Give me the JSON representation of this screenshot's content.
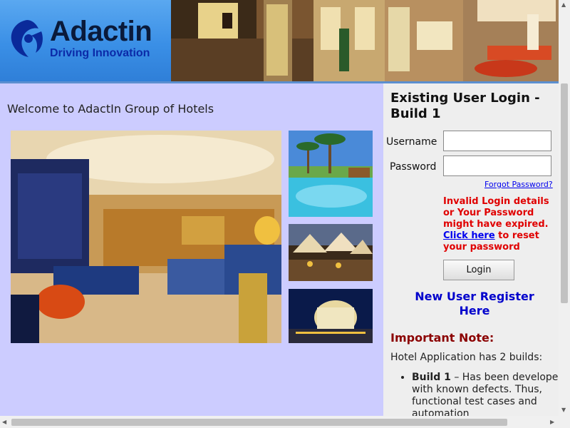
{
  "header": {
    "logo_name": "Adactin",
    "logo_tagline": "Driving Innovation"
  },
  "main": {
    "welcome": "Welcome to AdactIn Group of Hotels"
  },
  "login": {
    "title": "Existing User Login - Build 1",
    "username_label": "Username",
    "username_value": "",
    "password_label": "Password",
    "password_value": "",
    "forgot_link": "Forgot Password?",
    "error_text_1": "Invalid Login details or Your Password might have expired.",
    "error_link": "Click here",
    "error_text_2": "to reset your password",
    "login_button": "Login",
    "register_link": "New User Register Here"
  },
  "note": {
    "title": "Important Note:",
    "intro": "Hotel Application has 2 builds:",
    "item1_bold": "Build 1",
    "item1_text": "– Has been developed with known defects. Thus, functional test cases and automation"
  },
  "colors": {
    "left_bg": "#ccccff",
    "right_bg": "#eeeeee",
    "error": "#e00000",
    "link": "#0000ee",
    "note_title": "#8b0000"
  },
  "icons": {
    "logo": "adactin-logo-icon",
    "scroll_up": "arrow-up-icon",
    "scroll_down": "arrow-down-icon",
    "scroll_left": "arrow-left-icon",
    "scroll_right": "arrow-right-icon"
  }
}
